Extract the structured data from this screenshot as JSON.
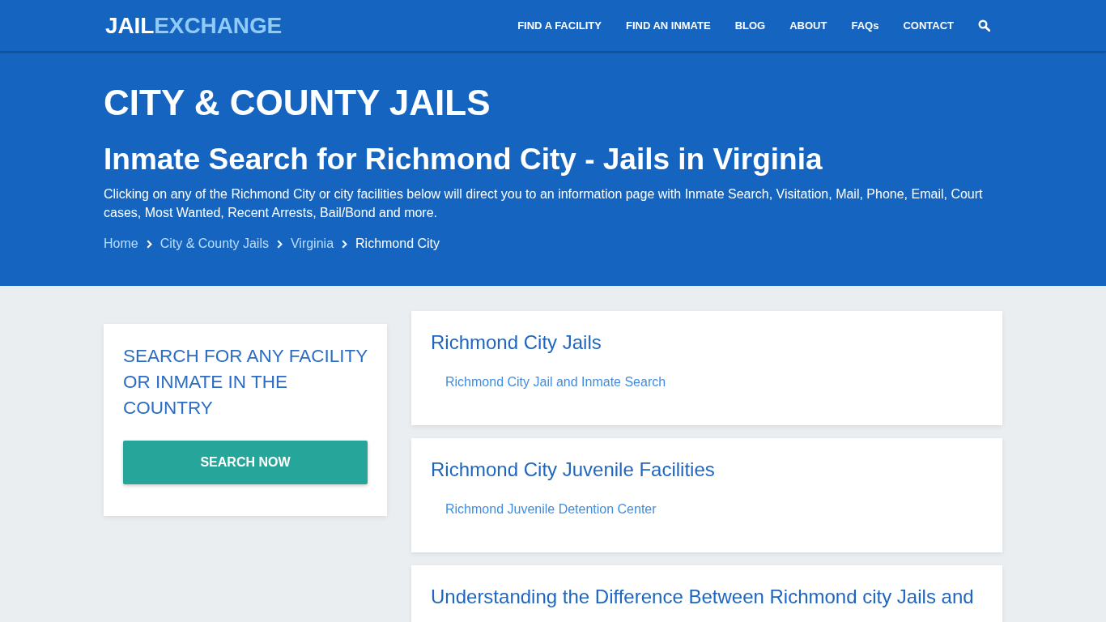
{
  "header": {
    "logo": {
      "prefix": "JAIL",
      "suffix": "EXCHANGE"
    },
    "nav": [
      "FIND A FACILITY",
      "FIND AN INMATE",
      "BLOG",
      "ABOUT",
      "FAQs",
      "CONTACT"
    ]
  },
  "hero": {
    "title": "CITY & COUNTY JAILS",
    "subtitle": "Inmate Search for Richmond City - Jails in Virginia",
    "description": "Clicking on any of the Richmond City or city facilities below will direct you to an information page with Inmate Search, Visitation, Mail, Phone, Email, Court cases, Most Wanted, Recent Arrests, Bail/Bond and more.",
    "breadcrumbs": [
      {
        "label": "Home",
        "current": false
      },
      {
        "label": "City & County Jails",
        "current": false
      },
      {
        "label": "Virginia",
        "current": false
      },
      {
        "label": "Richmond City",
        "current": true
      }
    ]
  },
  "sidebar": {
    "search_card": {
      "title": "SEARCH FOR ANY FACILITY OR INMATE IN THE COUNTRY",
      "button": "SEARCH NOW"
    }
  },
  "sections": [
    {
      "title": "Richmond City Jails",
      "links": [
        "Richmond City Jail and Inmate Search"
      ]
    },
    {
      "title": "Richmond City Juvenile Facilities",
      "links": [
        "Richmond Juvenile Detention Center"
      ]
    },
    {
      "title": "Understanding the Difference Between Richmond city Jails and"
    }
  ]
}
